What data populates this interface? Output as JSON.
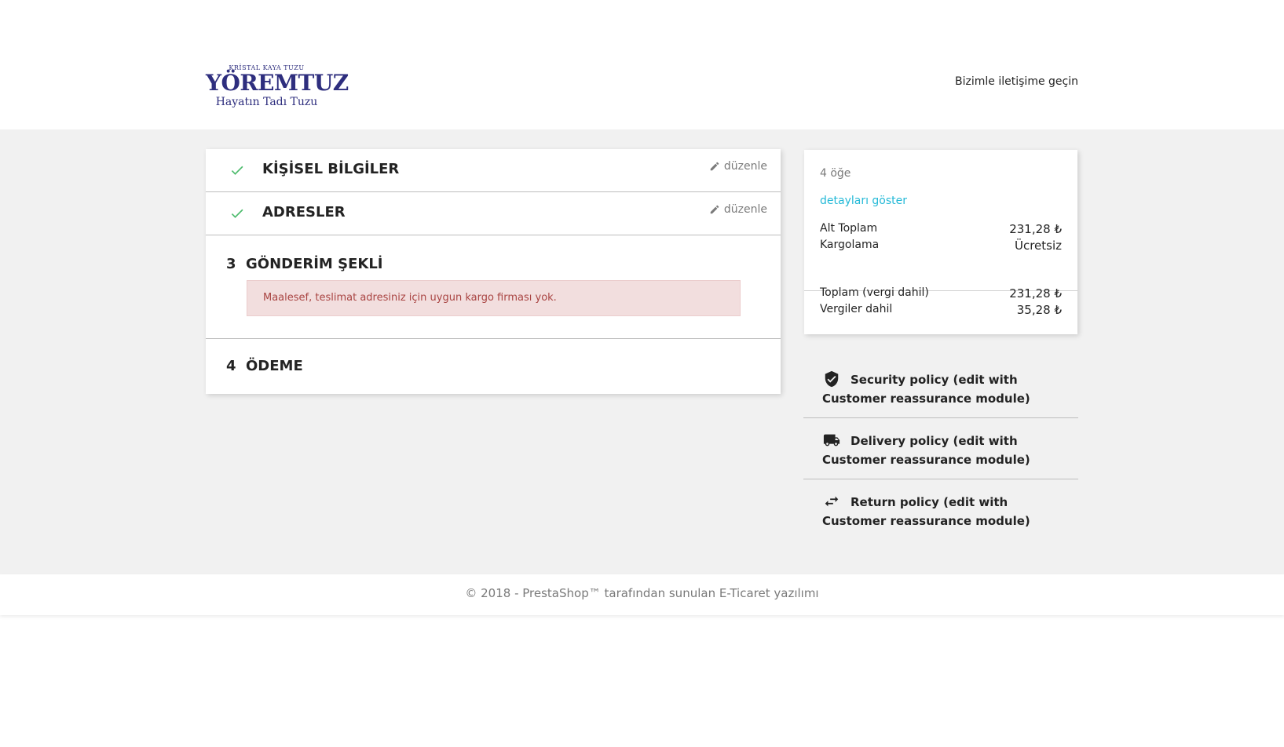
{
  "header": {
    "logo": {
      "top": "KRİSTAL KAYA TUZU",
      "main": "YÖREMTUZ",
      "sub": "Hayatın Tadı Tuzu"
    },
    "contact_link": "Bizimle iletişime geçin"
  },
  "checkout_steps": [
    {
      "status": "complete",
      "title": "KİŞİSEL BİLGİLER",
      "edit_label": "düzenle"
    },
    {
      "status": "complete",
      "title": "ADRESLER",
      "edit_label": "düzenle"
    },
    {
      "status": "current",
      "number": "3",
      "title": "GÖNDERİM ŞEKLİ",
      "alert": "Maalesef, teslimat adresiniz için uygun kargo firması yok."
    },
    {
      "status": "pending",
      "number": "4",
      "title": "ÖDEME"
    }
  ],
  "cart_summary": {
    "item_count": "4 öğe",
    "show_details": "detayları göster",
    "subtotal_label": "Alt Toplam",
    "subtotal_value": "231,28 ₺",
    "shipping_label": "Kargolama",
    "shipping_value": "Ücretsiz",
    "total_label": "Toplam (vergi dahil)",
    "total_value": "231,28 ₺",
    "taxes_label": "Vergiler dahil",
    "taxes_value": "35,28 ₺"
  },
  "reassurance": [
    {
      "icon": "shield-check-icon",
      "text": "Security policy (edit with Customer reassurance module)"
    },
    {
      "icon": "truck-icon",
      "text": "Delivery policy (edit with Customer reassurance module)"
    },
    {
      "icon": "swap-arrows-icon",
      "text": "Return policy (edit with Customer reassurance module)"
    }
  ],
  "footer": {
    "text": "© 2018 - PrestaShop™ tarafından sunulan E-Ticaret yazılımı"
  },
  "colors": {
    "check": "#4cbb6c",
    "link": "#24b9d7",
    "alert_bg": "#f2dede",
    "alert_text": "#a94442",
    "logo": "#2e2e7e"
  }
}
